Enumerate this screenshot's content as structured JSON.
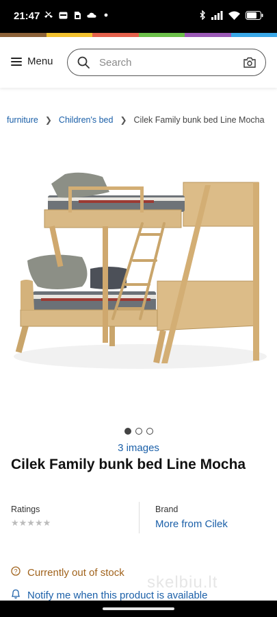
{
  "status_bar": {
    "time": "21:47",
    "left_icons": [
      "missed-call-icon",
      "mail-icon",
      "sim-icon",
      "cloud-icon",
      "dot-icon"
    ],
    "right_icons": [
      "bluetooth-icon",
      "signal-icon",
      "wifi-icon",
      "battery-icon"
    ]
  },
  "brand_strip_colors": [
    "#8c6239",
    "#f2c12e",
    "#e4614c",
    "#6cc04a",
    "#9b59b6",
    "#3aa8e8"
  ],
  "header": {
    "menu_label": "Menu",
    "search_placeholder": "Search"
  },
  "breadcrumb": {
    "items": [
      "furniture",
      "Children's bed"
    ],
    "current": "Cilek Family bunk bed Line Mocha"
  },
  "gallery": {
    "dots": 3,
    "active_dot": 1,
    "images_label": "3 images"
  },
  "product": {
    "brand": "Cilek",
    "name": "Family bunk bed Line Mocha"
  },
  "ratings": {
    "label": "Ratings",
    "stars": "★★★★★"
  },
  "brand_info": {
    "label": "Brand",
    "link": "More from Cilek"
  },
  "availability": {
    "stock_text": "Currently out of stock",
    "notify_text": "Notify me when this product is available"
  },
  "watermark": "skelbiu.lt",
  "colors": {
    "link": "#1a5fa8",
    "stock_warning": "#a0621b",
    "wood": "#d9b985"
  }
}
